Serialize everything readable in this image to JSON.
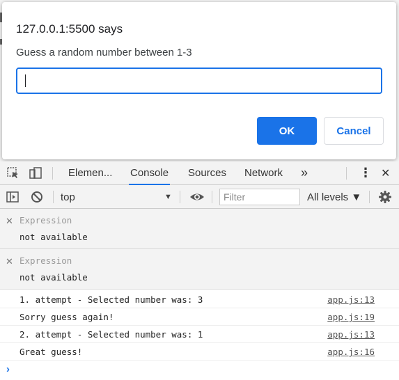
{
  "dialog": {
    "origin": "127.0.0.1:5500 says",
    "message": "Guess a random number between 1-3",
    "input_value": "",
    "ok_label": "OK",
    "cancel_label": "Cancel"
  },
  "devtools": {
    "tabs": [
      {
        "label": "Elemen..."
      },
      {
        "label": "Console"
      },
      {
        "label": "Sources"
      },
      {
        "label": "Network"
      }
    ],
    "more_tabs_glyph": "»",
    "menu_glyph": "⋮",
    "close_glyph": "✕",
    "toolbar": {
      "context": "top",
      "filter_placeholder": "Filter",
      "levels": "All levels ▼"
    },
    "expressions": [
      {
        "label": "Expression",
        "value": "not available"
      },
      {
        "label": "Expression",
        "value": "not available"
      }
    ],
    "messages": [
      {
        "text": "1. attempt - Selected number was: 3",
        "source": "app.js:13"
      },
      {
        "text": "Sorry guess again!",
        "source": "app.js:19"
      },
      {
        "text": "2. attempt - Selected number was: 1",
        "source": "app.js:13"
      },
      {
        "text": "Great guess!",
        "source": "app.js:16"
      }
    ],
    "prompt_glyph": "›"
  },
  "colors": {
    "accent": "#1a73e8",
    "panel_bg": "#f3f3f3"
  }
}
